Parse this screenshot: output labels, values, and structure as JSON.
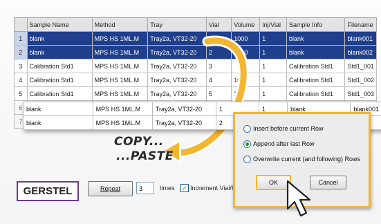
{
  "grid": {
    "columns": [
      "",
      "Sample Name",
      "Method",
      "Tray",
      "Vial",
      "Volume",
      "Inj/Vial",
      "Sample Info",
      "Filename"
    ],
    "rows": [
      {
        "n": "1",
        "name": "blank",
        "method": "MPS HS 1ML.M",
        "tray": "Tray2a, VT32-20",
        "vial": "1",
        "volume": "1000",
        "inj": "1",
        "info": "blank",
        "file": "blank001"
      },
      {
        "n": "2",
        "name": "blank",
        "method": "MPS HS 1ML.M",
        "tray": "Tray2a, VT32-20",
        "vial": "2",
        "volume": "1000",
        "inj": "1",
        "info": "blank",
        "file": "blank002"
      },
      {
        "n": "3",
        "name": "Calibration Std1",
        "method": "MPS HS 1ML.M",
        "tray": "Tray2a, VT32-20",
        "vial": "3",
        "volume": "",
        "inj": "1",
        "info": "Calibration Std1",
        "file": "Std1_001"
      },
      {
        "n": "4",
        "name": "Calibration Std1",
        "method": "MPS HS 1ML.M",
        "tray": "Tray2a, VT32-20",
        "vial": "4",
        "volume": "100",
        "inj": "1",
        "info": "Calibration Std1",
        "file": "Std1_002"
      },
      {
        "n": "5",
        "name": "Calibration Std1",
        "method": "MPS HS 1ML.M",
        "tray": "Tray2a, VT32-20",
        "vial": "5",
        "volume": "100",
        "inj": "1",
        "info": "Calibration Std1",
        "file": "Std1_003"
      },
      {
        "n": "6",
        "name": "",
        "method": "",
        "tray": "",
        "vial": "",
        "volume": "",
        "inj": "",
        "info": "",
        "file": ""
      },
      {
        "n": "7",
        "name": "",
        "method": "",
        "tray": "",
        "vial": "",
        "volume": "",
        "inj": "",
        "info": "",
        "file": ""
      }
    ]
  },
  "paste_rows": [
    {
      "name": "blank",
      "method": "MPS HS 1ML.M",
      "tray": "Tray2a, VT32-20",
      "vial": "1",
      "inj": "1",
      "info": "blank",
      "file": "blank001"
    },
    {
      "name": "blank",
      "method": "MPS HS 1ML.M",
      "tray": "Tray2a, VT32-20",
      "vial": "2",
      "inj": "",
      "info": "",
      "file": "02"
    }
  ],
  "caption": {
    "copy": "COPY...",
    "paste": "...PASTE"
  },
  "bottom": {
    "logo": "GERSTEL",
    "repeat_label": "Repeat",
    "repeat_value": "3",
    "times_label": "times",
    "increment_label": "Increment Vial/I"
  },
  "dialog": {
    "options": [
      {
        "label": "Insert before current Row",
        "selected": false
      },
      {
        "label": "Append after last Row",
        "selected": true
      },
      {
        "label": "Overwrite current (and following) Rows",
        "selected": false
      }
    ],
    "ok_label": "OK",
    "cancel_label": "Cancel"
  },
  "colors": {
    "selection": "#1f3f8c",
    "highlight": "#f2b632",
    "brand": "#6a3a8c"
  },
  "icons": {
    "copy_arrow": "curved-arrow-icon",
    "cursor": "mouse-pointer-icon"
  }
}
